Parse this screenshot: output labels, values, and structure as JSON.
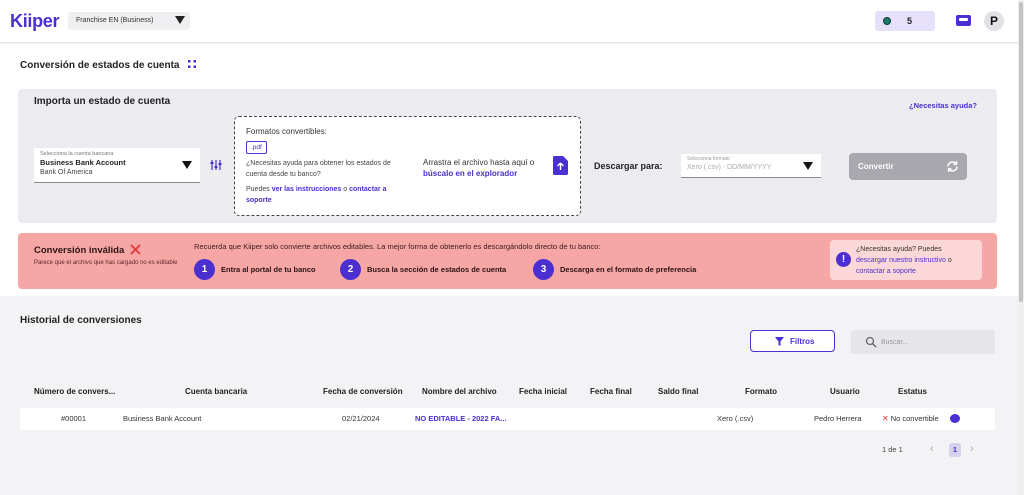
{
  "header": {
    "logo": "Kiiper",
    "franchise": "Franchise EN (Business)",
    "credits": "5",
    "avatar": "P"
  },
  "page": {
    "title": "Conversión de estados de cuenta"
  },
  "import": {
    "title": "Importa un estado de cuenta",
    "help_link": "¿Necesitas ayuda?",
    "bank_select": {
      "label": "Selecciona la cuenta bancaria",
      "value": "Business Bank Account",
      "sub": "Bank Of America"
    },
    "dropzone": {
      "title": "Formatos convertibles:",
      "format_chip": ".pdf",
      "help_text": "¿Necesitas ayuda para obtener los estados de cuenta desde tu banco?",
      "links_prefix": "Puedes ",
      "link_instructions": "ver las instrucciones",
      "links_or": " o ",
      "link_support": "contactar a soporte",
      "drag_text": "Arrastra el archivo hasta aquí o",
      "drag_link": "búscalo en el explorador"
    },
    "download_label": "Descargar para:",
    "format_select": {
      "label": "Selecciona formato",
      "placeholder": "Xero (.csv) - DD/MM/YYYY"
    },
    "convert_button": "Convertir"
  },
  "alert": {
    "title": "Conversión inválida",
    "description": "Parece que el archivo que has cargado no es editable",
    "message": "Recuerda que Kiiper solo convierte archivos editables. La mejor forma de obtenerlo es descargándolo directo de tu banco:",
    "steps": [
      {
        "num": "1",
        "text": "Entra al portal de tu banco"
      },
      {
        "num": "2",
        "text": "Busca la sección de estados de cuenta"
      },
      {
        "num": "3",
        "text": "Descarga en el formato de preferencia"
      }
    ],
    "help": {
      "prefix": "¿Necesitas ayuda? Puedes",
      "link1": "descargar nuestro instructivo",
      "or": " o ",
      "link2": "contactar a soporte"
    }
  },
  "history": {
    "title": "Historial de conversiones",
    "filter_button": "Filtros",
    "search_placeholder": "Buscar...",
    "columns": [
      "Número de convers...",
      "Cuenta bancaria",
      "Fecha de conversión",
      "Nombre del archivo",
      "Fecha inicial",
      "Fecha final",
      "Saldo final",
      "Formato",
      "Usuario",
      "Estatus"
    ],
    "rows": [
      {
        "number": "#00001",
        "account": "Business Bank Account",
        "date": "02/21/2024",
        "file": "NO EDITABLE - 2022 FA...",
        "start": "",
        "end": "",
        "balance": "",
        "format": "Xero (.csv)",
        "user": "Pedro Herrera",
        "status": "No convertible"
      }
    ],
    "pagination": {
      "info": "1 de 1",
      "current": "1"
    }
  },
  "colors": {
    "accent": "#4b2fd0",
    "alert_bg": "#f7a6a6",
    "error": "#e03b3b"
  }
}
